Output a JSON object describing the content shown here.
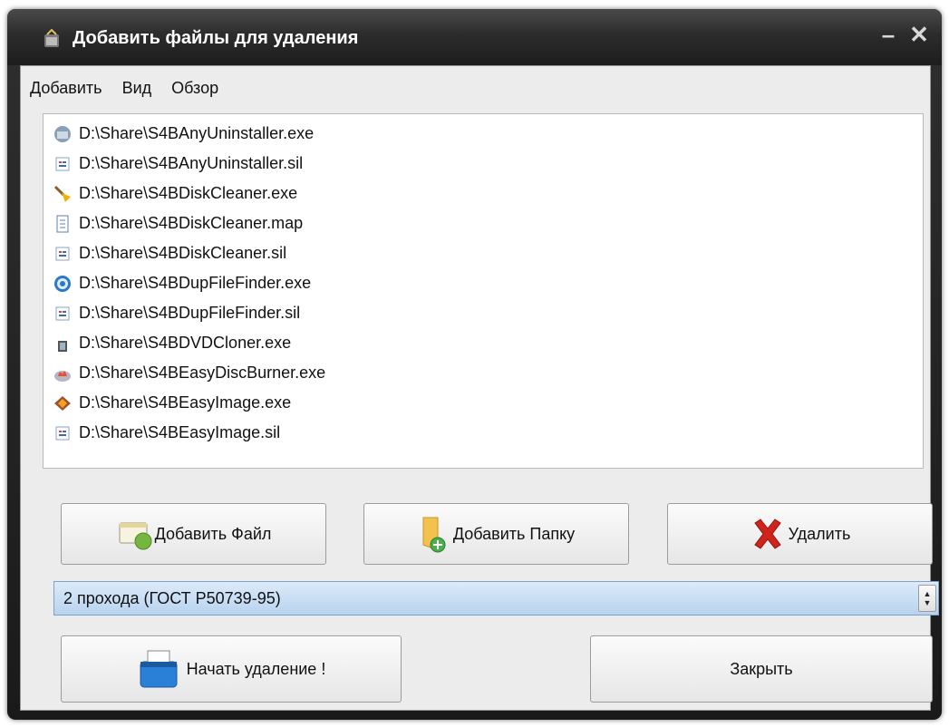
{
  "window": {
    "title": "Добавить файлы для удаления",
    "minimize_glyph": "–",
    "close_glyph": "✕"
  },
  "menu": [
    "Добавить",
    "Вид",
    "Обзор"
  ],
  "files": [
    {
      "path": "D:\\Share\\S4BAnyUninstaller.exe",
      "icon": "uninstaller-app-icon"
    },
    {
      "path": "D:\\Share\\S4BAnyUninstaller.sil",
      "icon": "sil-file-icon"
    },
    {
      "path": "D:\\Share\\S4BDiskCleaner.exe",
      "icon": "broom-icon"
    },
    {
      "path": "D:\\Share\\S4BDiskCleaner.map",
      "icon": "text-document-icon"
    },
    {
      "path": "D:\\Share\\S4BDiskCleaner.sil",
      "icon": "sil-file-icon"
    },
    {
      "path": "D:\\Share\\S4BDupFileFinder.exe",
      "icon": "globe-icon"
    },
    {
      "path": "D:\\Share\\S4BDupFileFinder.sil",
      "icon": "sil-file-icon"
    },
    {
      "path": "D:\\Share\\S4BDVDCloner.exe",
      "icon": "dvd-cloner-icon"
    },
    {
      "path": "D:\\Share\\S4BEasyDiscBurner.exe",
      "icon": "disc-burner-icon"
    },
    {
      "path": "D:\\Share\\S4BEasyImage.exe",
      "icon": "easy-image-icon"
    },
    {
      "path": "D:\\Share\\S4BEasyImage.sil",
      "icon": "sil-file-icon"
    }
  ],
  "buttons": {
    "add_file": "Добавить Файл",
    "add_folder": "Добавить Папку",
    "delete": "Удалить",
    "start": "Начать удаление !",
    "close": "Закрыть"
  },
  "method": {
    "selected": "2 прохода (ГОСТ Р50739-95)"
  },
  "colors": {
    "titlebar": "#2c2c2c",
    "client_bg": "#ececec",
    "select_bg": "#c9def4",
    "delete_x": "#d0231c"
  }
}
